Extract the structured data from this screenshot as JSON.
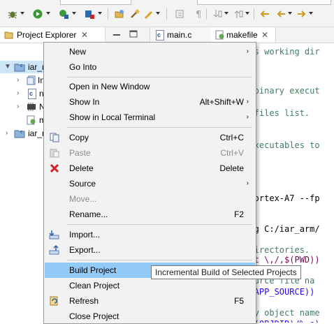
{
  "toolbar": {
    "icons": [
      "debug-icon",
      "run-icon",
      "run-config-icon",
      "stop-icon",
      "open-folder-icon",
      "build-tool-icon",
      "toggle-icon",
      "paragraph-icon",
      "next-annotation-icon",
      "previous-annotation-icon",
      "back-icon",
      "forward-icon"
    ]
  },
  "tabs": {
    "project_explorer": "Project Explorer",
    "editor_tabs": [
      {
        "label": "main.c",
        "icon": "c-file-icon"
      },
      {
        "label": "makefile",
        "icon": "makefile-icon"
      }
    ],
    "close_glyph": "✕"
  },
  "tree": {
    "rows": [
      {
        "label": "iar_r",
        "expanded": true
      },
      {
        "label": "In"
      },
      {
        "label": "n"
      },
      {
        "label": "N"
      },
      {
        "label": "m"
      },
      {
        "label": "iar_n",
        "expanded": false
      }
    ]
  },
  "editor": {
    "lines": [
      {
        "text": "ects working dir",
        "color": "#3f7f5f"
      },
      {
        "text": "ut binary execut",
        "color": "#3f7f5f"
      },
      {
        "text": "ut",
        "color": "#000000"
      },
      {
        "text": "ce files list.",
        "color": "#3f7f5f"
      },
      {
        "text": "c",
        "color": "#000000"
      },
      {
        "text": "n executables to",
        "color": "#3f7f5f"
      },
      {
        "text": "u Cortex-A7 --fp",
        "color": "#000000"
      },
      {
        "text": "nfig C:/iar_arm/",
        "color": "#000000"
      },
      {
        "text": "e directories.",
        "color": "#3f7f5f"
      },
      {
        "text": "ubst \\,/,$(PWD))",
        "color": "#7f0055"
      },
      {
        "text": " source file na",
        "color": "#3f7f5f"
      },
      {
        "text": " $(APP_SOURCE))",
        "color": "#2a00ff"
      },
      {
        "text": "iary object name",
        "color": "#3f7f5f"
      },
      {
        "text": "e=$(OBJDIR)/% o)",
        "color": "#2a00ff"
      }
    ]
  },
  "context_menu": {
    "items": [
      {
        "label": "New",
        "submenu": true
      },
      {
        "label": "Go Into"
      },
      {
        "label": "Open in New Window"
      },
      {
        "label": "Show In",
        "accel": "Alt+Shift+W",
        "submenu": true
      },
      {
        "label": "Show in Local Terminal",
        "submenu": true
      },
      {
        "label": "Copy",
        "accel": "Ctrl+C",
        "icon": "copy-icon"
      },
      {
        "label": "Paste",
        "accel": "Ctrl+V",
        "icon": "paste-icon",
        "disabled": true
      },
      {
        "label": "Delete",
        "accel": "Delete",
        "icon": "delete-icon"
      },
      {
        "label": "Source",
        "submenu": true
      },
      {
        "label": "Move...",
        "disabled": true
      },
      {
        "label": "Rename...",
        "accel": "F2"
      },
      {
        "label": "Import...",
        "icon": "import-icon"
      },
      {
        "label": "Export...",
        "icon": "export-icon"
      },
      {
        "label": "Build Project",
        "highlighted": true
      },
      {
        "label": "Clean Project"
      },
      {
        "label": "Refresh",
        "accel": "F5",
        "icon": "refresh-icon"
      },
      {
        "label": "Close Project"
      }
    ],
    "submenu_glyph": "›"
  },
  "tooltip": {
    "text": "Incremental Build of Selected Projects"
  }
}
